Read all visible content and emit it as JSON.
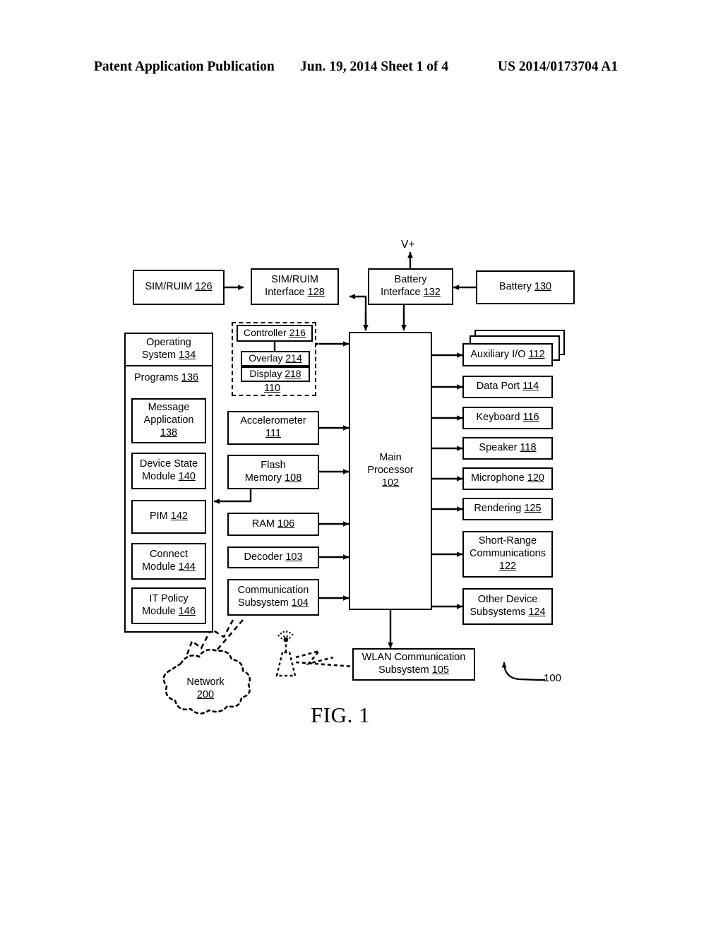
{
  "header": {
    "publication": "Patent Application Publication",
    "date_sheet": "Jun. 19, 2014  Sheet 1 of 4",
    "patent_number": "US 2014/0173704 A1"
  },
  "figure": {
    "caption": "FIG. 1",
    "reference_numeral": "100",
    "power_label": "V+"
  },
  "chart_data": {
    "type": "diagram",
    "title": "FIG. 1",
    "description": "Block diagram of a mobile communication device (100)",
    "nodes": [
      {
        "id": "126",
        "label": "SIM/RUIM",
        "number": "126"
      },
      {
        "id": "128",
        "label": "SIM/RUIM Interface",
        "number": "128"
      },
      {
        "id": "132",
        "label": "Battery Interface",
        "number": "132"
      },
      {
        "id": "130",
        "label": "Battery",
        "number": "130"
      },
      {
        "id": "134",
        "label": "Operating System",
        "number": "134"
      },
      {
        "id": "136",
        "label": "Programs",
        "number": "136"
      },
      {
        "id": "138",
        "label": "Message Application",
        "number": "138"
      },
      {
        "id": "140",
        "label": "Device State Module",
        "number": "140"
      },
      {
        "id": "142",
        "label": "PIM",
        "number": "142"
      },
      {
        "id": "144",
        "label": "Connect Module",
        "number": "144"
      },
      {
        "id": "146",
        "label": "IT Policy Module",
        "number": "146"
      },
      {
        "id": "216",
        "label": "Controller",
        "number": "216"
      },
      {
        "id": "214",
        "label": "Overlay",
        "number": "214"
      },
      {
        "id": "218",
        "label": "Display",
        "number": "218"
      },
      {
        "id": "110",
        "label": "Display subsystem",
        "number": "110"
      },
      {
        "id": "111",
        "label": "Accelerometer",
        "number": "111"
      },
      {
        "id": "108",
        "label": "Flash Memory",
        "number": "108"
      },
      {
        "id": "106",
        "label": "RAM",
        "number": "106"
      },
      {
        "id": "103",
        "label": "Decoder",
        "number": "103"
      },
      {
        "id": "104",
        "label": "Communication Subsystem",
        "number": "104"
      },
      {
        "id": "102",
        "label": "Main Processor",
        "number": "102"
      },
      {
        "id": "112",
        "label": "Auxiliary I/O",
        "number": "112"
      },
      {
        "id": "114",
        "label": "Data Port",
        "number": "114"
      },
      {
        "id": "116",
        "label": "Keyboard",
        "number": "116"
      },
      {
        "id": "118",
        "label": "Speaker",
        "number": "118"
      },
      {
        "id": "120",
        "label": "Microphone",
        "number": "120"
      },
      {
        "id": "125",
        "label": "Rendering",
        "number": "125"
      },
      {
        "id": "122",
        "label": "Short-Range Communications",
        "number": "122"
      },
      {
        "id": "124",
        "label": "Other Device Subsystems",
        "number": "124"
      },
      {
        "id": "105",
        "label": "WLAN Communication Subsystem",
        "number": "105"
      },
      {
        "id": "200",
        "label": "Network",
        "number": "200"
      }
    ],
    "edges": [
      {
        "from": "126",
        "to": "128",
        "type": "bidirectional"
      },
      {
        "from": "130",
        "to": "132",
        "type": "directed"
      },
      {
        "from": "132",
        "to": "V+",
        "type": "directed"
      },
      {
        "from": "132",
        "to": "128",
        "type": "directed"
      },
      {
        "from": "132",
        "to": "102",
        "type": "directed"
      },
      {
        "from": "128",
        "to": "102",
        "type": "directed"
      },
      {
        "from": "110",
        "to": "102",
        "type": "bidirectional"
      },
      {
        "from": "111",
        "to": "102",
        "type": "bidirectional"
      },
      {
        "from": "108",
        "to": "102",
        "type": "bidirectional"
      },
      {
        "from": "106",
        "to": "102",
        "type": "bidirectional"
      },
      {
        "from": "103",
        "to": "102",
        "type": "bidirectional"
      },
      {
        "from": "104",
        "to": "102",
        "type": "bidirectional"
      },
      {
        "from": "108",
        "to": "136",
        "type": "directed"
      },
      {
        "from": "102",
        "to": "112",
        "type": "bidirectional"
      },
      {
        "from": "102",
        "to": "114",
        "type": "bidirectional"
      },
      {
        "from": "102",
        "to": "116",
        "type": "bidirectional"
      },
      {
        "from": "102",
        "to": "118",
        "type": "bidirectional"
      },
      {
        "from": "102",
        "to": "120",
        "type": "bidirectional"
      },
      {
        "from": "102",
        "to": "125",
        "type": "bidirectional"
      },
      {
        "from": "102",
        "to": "122",
        "type": "bidirectional"
      },
      {
        "from": "102",
        "to": "124",
        "type": "bidirectional"
      },
      {
        "from": "102",
        "to": "105",
        "type": "bidirectional"
      },
      {
        "from": "104",
        "to": "200",
        "type": "wireless"
      },
      {
        "from": "105",
        "to": "access-point",
        "type": "wireless"
      }
    ]
  },
  "power": {
    "rail_label": "V+"
  },
  "top_row": {
    "sim_ruim": {
      "line1": "SIM/RUIM",
      "num": "126"
    },
    "sim_ruim_interface": {
      "line1": "SIM/RUIM",
      "line2": "Interface",
      "num": "128"
    },
    "battery_interface": {
      "line1": "Battery",
      "line2": "Interface",
      "num": "132"
    },
    "battery": {
      "line1": "Battery",
      "num": "130"
    }
  },
  "software": {
    "operating_system": {
      "line1": "Operating",
      "line2": "System",
      "num": "134"
    },
    "programs": {
      "line1": "Programs",
      "num": "136"
    },
    "message_application": {
      "line1": "Message",
      "line2": "Application",
      "num": "138"
    },
    "device_state_module": {
      "line1": "Device State",
      "line2": "Module",
      "num": "140"
    },
    "pim": {
      "line1": "PIM",
      "num": "142"
    },
    "connect_module": {
      "line1": "Connect",
      "line2": "Module",
      "num": "144"
    },
    "it_policy_module": {
      "line1": "IT Policy",
      "line2": "Module",
      "num": "146"
    }
  },
  "middle": {
    "controller": {
      "line1": "Controller",
      "num": "216"
    },
    "overlay": {
      "line1": "Overlay",
      "num": "214"
    },
    "display": {
      "line1": "Display",
      "num": "218"
    },
    "display_group_num": "110",
    "accelerometer": {
      "line1": "Accelerometer",
      "num": "111"
    },
    "flash_memory": {
      "line1": "Flash",
      "line2": "Memory",
      "num": "108"
    },
    "ram": {
      "line1": "RAM",
      "num": "106"
    },
    "decoder": {
      "line1": "Decoder",
      "num": "103"
    },
    "communication_subsystem": {
      "line1": "Communication",
      "line2": "Subsystem",
      "num": "104"
    }
  },
  "processor": {
    "line1": "Main",
    "line2": "Processor",
    "num": "102"
  },
  "peripherals": {
    "auxiliary_io": {
      "line1": "Auxiliary I/O",
      "num": "112"
    },
    "data_port": {
      "line1": "Data Port",
      "num": "114"
    },
    "keyboard": {
      "line1": "Keyboard",
      "num": "116"
    },
    "speaker": {
      "line1": "Speaker",
      "num": "118"
    },
    "microphone": {
      "line1": "Microphone",
      "num": "120"
    },
    "rendering": {
      "line1": "Rendering",
      "num": "125"
    },
    "short_range": {
      "line1": "Short-Range",
      "line2": "Communications",
      "num": "122"
    },
    "other_device": {
      "line1": "Other Device",
      "line2": "Subsystems",
      "num": "124"
    }
  },
  "bottom": {
    "wlan": {
      "line1": "WLAN Communication",
      "line2": "Subsystem",
      "num": "105"
    },
    "network": {
      "line1": "Network",
      "num": "200"
    }
  }
}
